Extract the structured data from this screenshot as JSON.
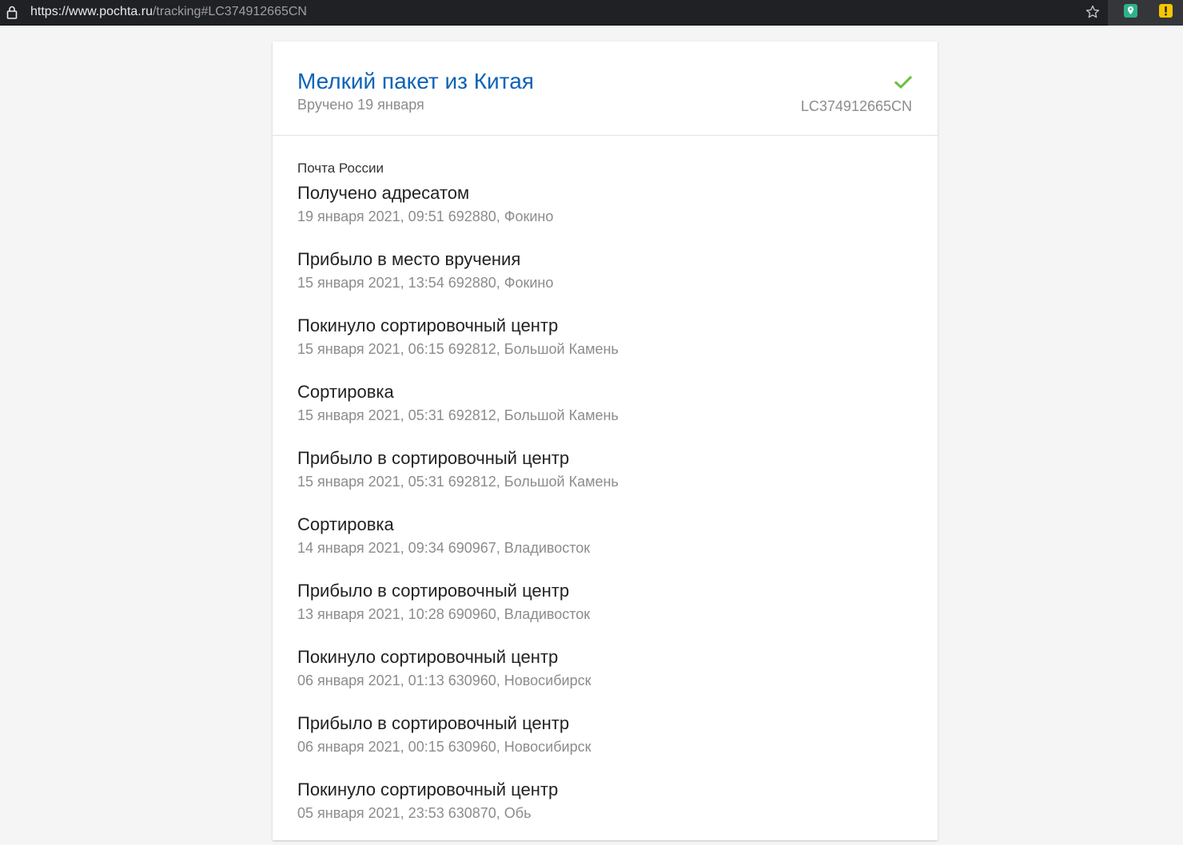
{
  "browser": {
    "url_main": "https://www.pochta.ru",
    "url_path": "/tracking#LC374912665CN",
    "icons": {
      "lock": "lock-icon",
      "star": "star-icon",
      "ext1": "map-pin-extension-icon",
      "ext2": "info-extension-icon"
    },
    "colors": {
      "bar": "#202124",
      "ext1": "#2bb38a",
      "ext2": "#f7c600"
    }
  },
  "parcel": {
    "title": "Мелкий пакет из Китая",
    "status": "Вручено 19 января",
    "tracking_number": "LC374912665CN",
    "status_icon": "check-icon",
    "colors": {
      "title": "#0b63b8",
      "check": "#6cbf3f"
    }
  },
  "history": {
    "carrier": "Почта России",
    "events": [
      {
        "title": "Получено адресатом",
        "meta": "19 января 2021, 09:51 692880, Фокино"
      },
      {
        "title": "Прибыло в место вручения",
        "meta": "15 января 2021, 13:54 692880, Фокино"
      },
      {
        "title": "Покинуло сортировочный центр",
        "meta": "15 января 2021, 06:15 692812, Большой Камень"
      },
      {
        "title": "Сортировка",
        "meta": "15 января 2021, 05:31 692812, Большой Камень"
      },
      {
        "title": "Прибыло в сортировочный центр",
        "meta": "15 января 2021, 05:31 692812, Большой Камень"
      },
      {
        "title": "Сортировка",
        "meta": "14 января 2021, 09:34 690967, Владивосток"
      },
      {
        "title": "Прибыло в сортировочный центр",
        "meta": "13 января 2021, 10:28 690960, Владивосток"
      },
      {
        "title": "Покинуло сортировочный центр",
        "meta": "06 января 2021, 01:13 630960, Новосибирск"
      },
      {
        "title": "Прибыло в сортировочный центр",
        "meta": "06 января 2021, 00:15 630960, Новосибирск"
      },
      {
        "title": "Покинуло сортировочный центр",
        "meta": "05 января 2021, 23:53 630870, Обь"
      }
    ]
  }
}
